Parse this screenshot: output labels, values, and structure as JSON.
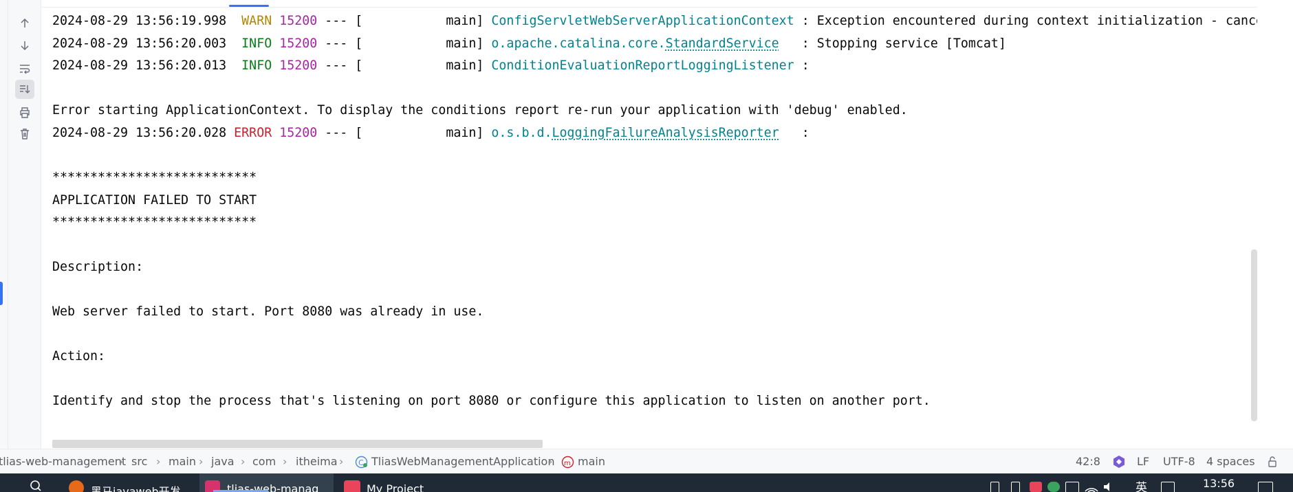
{
  "console": {
    "lines": [
      {
        "ts": "2024-08-29 13:56:19.998",
        "level": " WARN",
        "pid": "15200",
        "thread": "--- [           main]",
        "logger": "ConfigServletWebServerApplicationContext",
        "message": ": Exception encountered during context initialization - cancel"
      },
      {
        "ts": "2024-08-29 13:56:20.003",
        "level": " INFO",
        "pid": "15200",
        "thread": "--- [           main]",
        "logger_prefix": "o.apache.catalina.core.",
        "logger_link": "StandardService",
        "message": "  : Stopping service [Tomcat]"
      },
      {
        "ts": "2024-08-29 13:56:20.013",
        "level": " INFO",
        "pid": "15200",
        "thread": "--- [           main]",
        "logger": "ConditionEvaluationReportLoggingListener",
        "message": ":"
      },
      {
        "ts": "2024-08-29 13:56:20.028",
        "level": "ERROR",
        "pid": "15200",
        "thread": "--- [           main]",
        "logger_prefix": "o.s.b.d.",
        "logger_link": "LoggingFailureAnalysisReporter",
        "message": "  :"
      }
    ],
    "error_start": "Error starting ApplicationContext. To display the conditions report re-run your application with 'debug' enabled.",
    "stars": "***************************",
    "failed": "APPLICATION FAILED TO START",
    "description_label": "Description:",
    "description": "Web server failed to start. Port 8080 was already in use.",
    "action_label": "Action:",
    "action": "Identify and stop the process that's listening on port 8080 or configure this application to listen on another port."
  },
  "toolbar": {
    "icons": [
      "arrow-up-icon",
      "arrow-down-icon",
      "soft-wrap-icon",
      "scroll-to-end-icon",
      "print-icon",
      "trash-icon"
    ]
  },
  "statusbar": {
    "breadcrumbs": [
      "tlias-web-management",
      "src",
      "main",
      "java",
      "com",
      "itheima",
      "TliasWebManagementApplication",
      "main"
    ],
    "position": "42:8",
    "line_ending": "LF",
    "encoding": "UTF-8",
    "indent": "4 spaces"
  },
  "taskbar": {
    "tasks": [
      "黑马javaweb开发",
      "tlias-web-manag",
      "My Project"
    ],
    "time": "13:56",
    "ime": "英"
  },
  "colors": {
    "accent": "#3574f0",
    "warn": "#b38600",
    "info": "#067d17",
    "error": "#c7222d",
    "pid": "#a626a4",
    "logger": "#00838f"
  }
}
